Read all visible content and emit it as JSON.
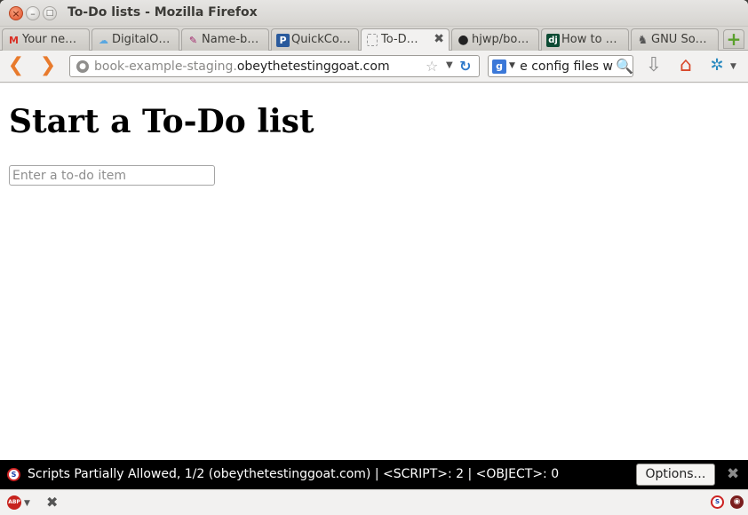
{
  "window": {
    "title": "To-Do lists - Mozilla Firefox",
    "close_glyph": "×",
    "minimize_glyph": "–",
    "maximize_glyph": "□"
  },
  "tabs": [
    {
      "label": "Your ne…",
      "icon": "gmail-icon",
      "glyph": "M",
      "color": "#d93025",
      "active": false
    },
    {
      "label": "DigitalO…",
      "icon": "cloud-icon",
      "glyph": "☁",
      "color": "#5aa7e0",
      "active": false
    },
    {
      "label": "Name-b…",
      "icon": "feather-icon",
      "glyph": "✎",
      "color": "#a0246a",
      "active": false
    },
    {
      "label": "QuickCo…",
      "icon": "python-icon",
      "glyph": "P",
      "color": "#2a5a9c",
      "active": false
    },
    {
      "label": "To-D…",
      "icon": "blank-page-icon",
      "glyph": "",
      "color": "#999999",
      "active": true,
      "close_glyph": "✖"
    },
    {
      "label": "hjwp/bo…",
      "icon": "github-icon",
      "glyph": "●",
      "color": "#222222",
      "active": false
    },
    {
      "label": "How to …",
      "icon": "django-icon",
      "glyph": "dj",
      "color": "#0c4b33",
      "active": false
    },
    {
      "label": "GNU So…",
      "icon": "gnu-icon",
      "glyph": "♞",
      "color": "#555555",
      "active": false
    }
  ],
  "new_tab_glyph": "+",
  "nav": {
    "back_glyph": "❮",
    "forward_glyph": "❯",
    "url_subdomain": "book-example-staging.",
    "url_host": "obeythetestinggoat.com",
    "bookmark_glyph": "☆",
    "dropdown_glyph": "▼",
    "reload_glyph": "↻",
    "search_engine_glyph": "g",
    "search_text": "the config files w",
    "search_glyph": "🔍",
    "download_glyph": "⇩",
    "home_glyph": "⌂",
    "extension_glyph": "✲"
  },
  "page": {
    "heading": "Start a To-Do list",
    "input_placeholder": "Enter a to-do item"
  },
  "noscript": {
    "icon_glyph": "S",
    "message": "Scripts Partially Allowed, 1/2 (obeythetestinggoat.com) | <SCRIPT>: 2 | <OBJECT>: 0",
    "options_label": "Options…",
    "close_glyph": "✖"
  },
  "addon_bar": {
    "abp_label": "ABP",
    "dropdown_glyph": "▼",
    "close_glyph": "✖",
    "noscript_glyph": "S",
    "ghost_glyph": "◉"
  }
}
